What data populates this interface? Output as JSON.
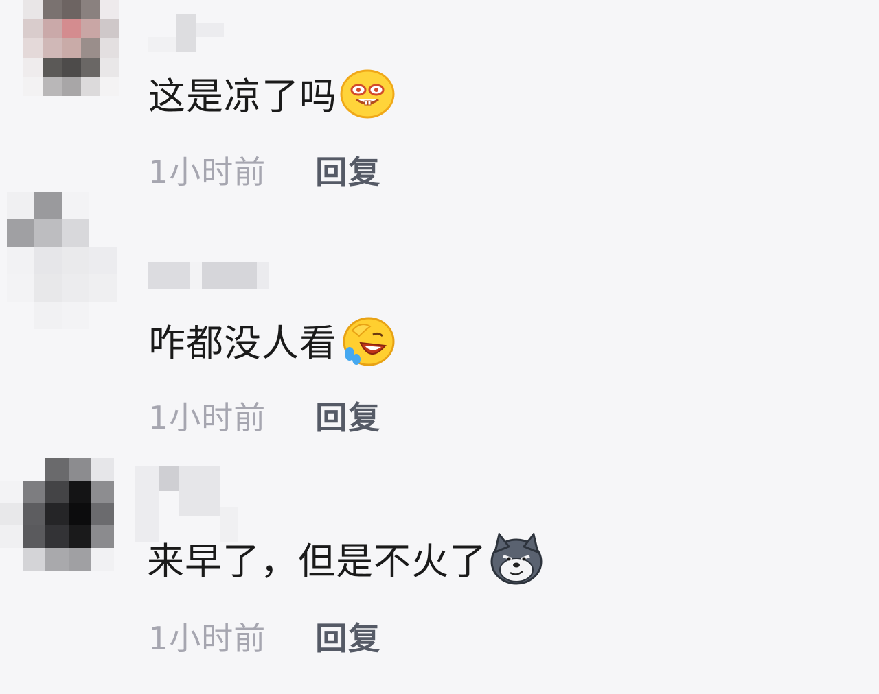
{
  "comments": [
    {
      "text": "这是凉了吗",
      "emoji_icon": "drooling-face-emoji",
      "time": "1小时前",
      "reply_label": "回复"
    },
    {
      "text": "咋都没人看",
      "emoji_icon": "rofl-laughing-emoji",
      "time": "1小时前",
      "reply_label": "回复"
    },
    {
      "text": "来早了，但是不火了",
      "emoji_icon": "doge-wolf-emoji",
      "time": "1小时前",
      "reply_label": "回复"
    }
  ],
  "colors": {
    "background": "#f6f6f8",
    "text": "#1a1a1a",
    "time": "#a6a6b0",
    "reply": "#555a66"
  }
}
